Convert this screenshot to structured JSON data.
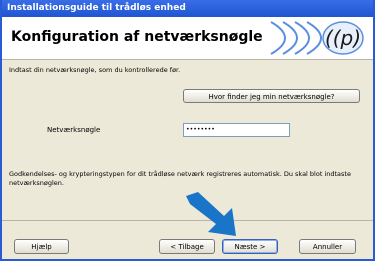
{
  "window": {
    "title": "Installationsguide til trådløs enhed"
  },
  "header": {
    "title": "Konfiguration af netværksnøgle",
    "logo_icon": "wireless-signal-icon"
  },
  "main": {
    "instruction": "Indtast din netværksnøgle, som du kontrollerede før.",
    "where_button_label": "Hvor finder jeg min netværksnøgle?",
    "key_label": "Netværksnøgle",
    "key_value": "••••••••",
    "note": "Godkendelses- og krypteringstypen for dit trådløse netværk registreres automatisk. Du skal blot indtaste netværksnøglen."
  },
  "footer": {
    "help_label": "Hjælp",
    "back_label": "< Tilbage",
    "next_label": "Næste >",
    "cancel_label": "Annuller"
  },
  "colors": {
    "titlebar": "#2a5bd7",
    "arrow": "#1a74c8",
    "face": "#ece9d8"
  },
  "icons": {
    "arrow": "pointer-arrow-icon"
  }
}
